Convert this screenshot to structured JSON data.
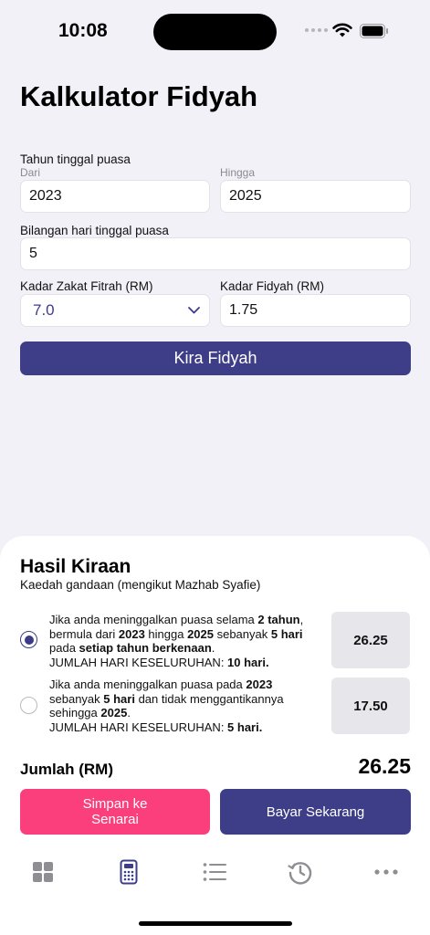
{
  "status_bar": {
    "time": "10:08"
  },
  "page": {
    "title": "Kalkulator Fidyah"
  },
  "form": {
    "tahun_label": "Tahun tinggal puasa",
    "dari_label": "Dari",
    "dari_value": "2023",
    "hingga_label": "Hingga",
    "hingga_value": "2025",
    "hari_label": "Bilangan hari tinggal puasa",
    "hari_value": "5",
    "zakat_label": "Kadar Zakat Fitrah (RM)",
    "zakat_value": "7.0",
    "fidyah_label": "Kadar Fidyah (RM)",
    "fidyah_value": "1.75",
    "kira_button": "Kira Fidyah"
  },
  "result": {
    "title": "Hasil Kiraan",
    "subtitle": "Kaedah gandaan (mengikut Mazhab Syafie)",
    "option1": {
      "t1": "Jika anda meninggalkan puasa selama ",
      "b1": "2 tahun",
      "t2": ", bermula dari ",
      "b2": "2023",
      "t3": " hingga ",
      "b3": "2025",
      "t4": " sebanyak ",
      "b4": "5 hari",
      "t5": " pada ",
      "b5": "setiap tahun berkenaan",
      "t6": ".",
      "total_label": "JUMLAH HARI KESELURUHAN: ",
      "total_value": "10 hari.",
      "amount": "26.25",
      "selected": true
    },
    "option2": {
      "t1": "Jika anda meninggalkan puasa pada ",
      "b1": "2023",
      "t2": " sebanyak ",
      "b2": "5 hari",
      "t3": " dan tidak menggantikannya sehingga ",
      "b3": "2025",
      "t4": ".",
      "total_label": "JUMLAH HARI KESELURUHAN: ",
      "total_value": "5 hari.",
      "amount": "17.50",
      "selected": false
    },
    "jumlah_label": "Jumlah (RM)",
    "jumlah_value": "26.25",
    "simpan_button": "Simpan ke Senarai",
    "bayar_button": "Bayar Sekarang"
  },
  "tab_bar": {
    "items": [
      "grid-icon",
      "calculator-icon",
      "list-icon",
      "history-icon",
      "more-icon"
    ],
    "active": "calculator-icon"
  },
  "colors": {
    "primary": "#3d3d88",
    "pink": "#fb3f7d",
    "background": "#f2f1f7"
  }
}
